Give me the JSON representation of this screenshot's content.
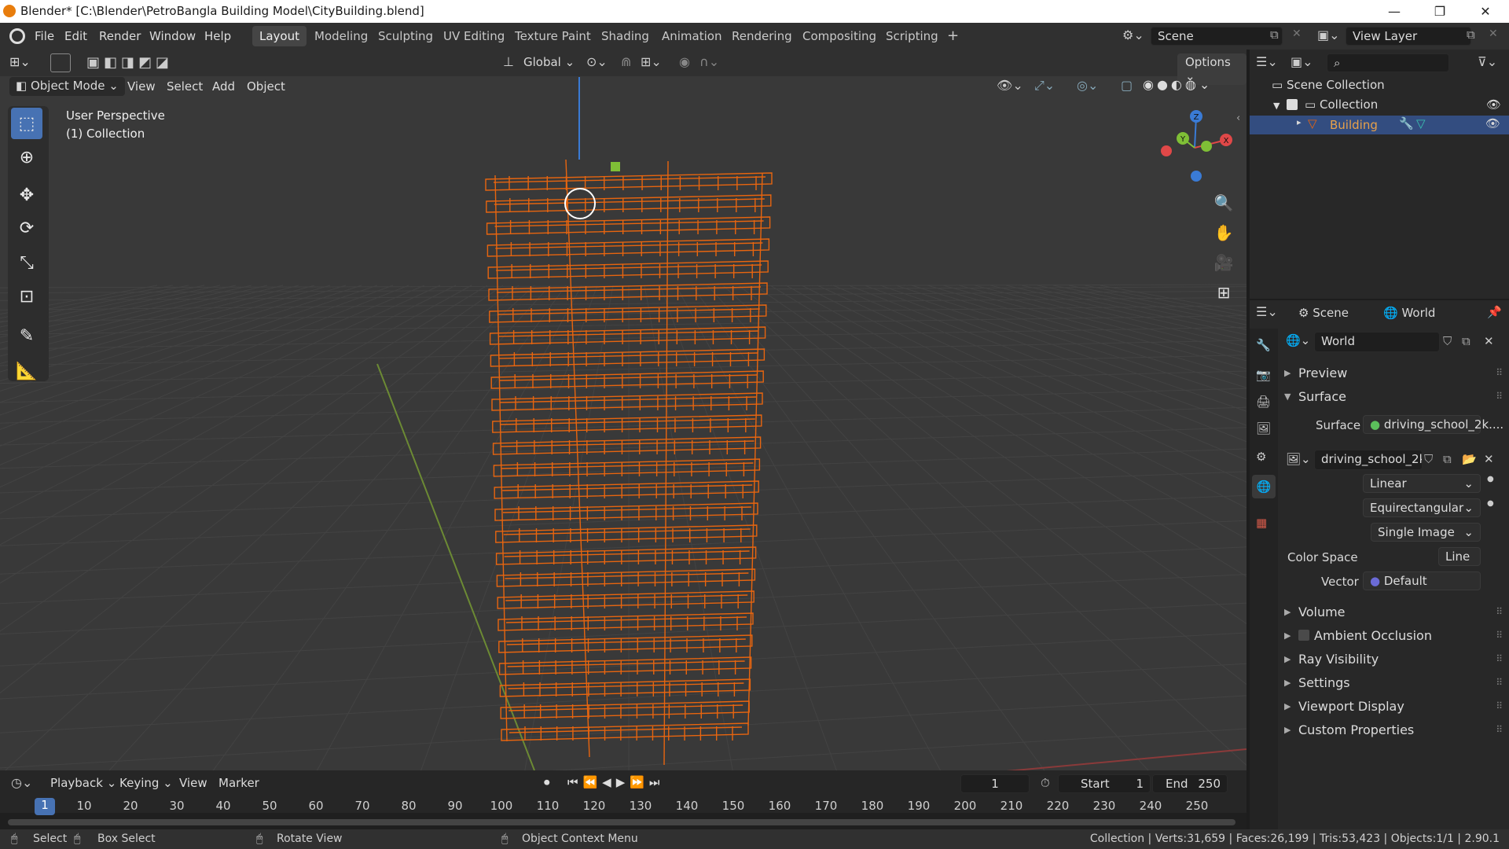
{
  "window": {
    "title": "Blender* [C:\\Blender\\PetroBangla Building Model\\CityBuilding.blend]",
    "controls": [
      "—",
      "❐",
      "✕"
    ]
  },
  "menubar": [
    "File",
    "Edit",
    "Render",
    "Window",
    "Help"
  ],
  "workspaces": [
    "Layout",
    "Modeling",
    "Sculpting",
    "UV Editing",
    "Texture Paint",
    "Shading",
    "Animation",
    "Rendering",
    "Compositing",
    "Scripting"
  ],
  "active_workspace": "Layout",
  "add_workspace": "+",
  "scene_field": "Scene",
  "view_layer_field": "View Layer",
  "viewport": {
    "transform_orientation": "Global",
    "options_label": "Options",
    "mode": "Object Mode",
    "header_menus": [
      "View",
      "Select",
      "Add",
      "Object"
    ],
    "overlay_title": "User Perspective",
    "overlay_collection": "(1) Collection",
    "gizmo_axes": {
      "z": "Z",
      "y": "Y",
      "x": "X"
    }
  },
  "outliner": {
    "search_placeholder": "",
    "scene_collection": "Scene Collection",
    "collection": "Collection",
    "object": "Building"
  },
  "properties": {
    "tab_scene": "Scene",
    "tab_world": "World",
    "world_name": "World",
    "panels_top": [
      "Preview",
      "Surface"
    ],
    "surface_label": "Surface",
    "surface_value": "driving_school_2k....",
    "image_name": "driving_school_2k...",
    "interpolation": "Linear",
    "projection": "Equirectangular",
    "source": "Single Image",
    "color_space_label": "Color Space",
    "color_space_value": "Line",
    "vector_label": "Vector",
    "vector_value": "Default",
    "panels_bottom": [
      "Volume",
      "Ambient Occlusion",
      "Ray Visibility",
      "Settings",
      "Viewport Display",
      "Custom Properties"
    ]
  },
  "timeline": {
    "menus": [
      "Playback",
      "Keying",
      "View",
      "Marker"
    ],
    "current_frame": "1",
    "start_label": "Start",
    "start_value": "1",
    "end_label": "End",
    "end_value": "250",
    "frame_marker": "1",
    "ticks": [
      "10",
      "20",
      "30",
      "40",
      "50",
      "60",
      "70",
      "80",
      "90",
      "100",
      "110",
      "120",
      "130",
      "140",
      "150",
      "160",
      "170",
      "180",
      "190",
      "200",
      "210",
      "220",
      "230",
      "240",
      "250"
    ]
  },
  "statusbar": {
    "select": "Select",
    "box_select": "Box Select",
    "rotate_view": "Rotate View",
    "context_menu": "Object Context Menu",
    "stats": "Collection | Verts:31,659 | Faces:26,199 | Tris:53,423 | Objects:1/1 | 2.90.1"
  },
  "colors": {
    "accent": "#4772b3",
    "selected_wire": "#e8650f",
    "world_icon": "#d45a4a",
    "axis_x": "#e04848",
    "axis_y": "#7fbf36",
    "axis_z": "#3a7bd5"
  }
}
